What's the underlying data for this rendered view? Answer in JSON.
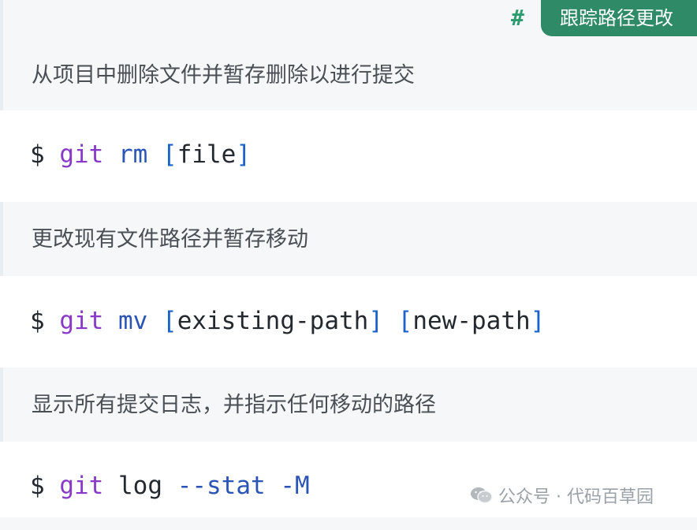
{
  "section": {
    "anchor": "#",
    "tag_label": "跟踪路径更改"
  },
  "items": [
    {
      "description": "从项目中删除文件并暂存删除以进行提交",
      "command": {
        "prompt": "$",
        "tool": "git",
        "subcommand": "rm",
        "args": [
          {
            "open": "[",
            "text": "file",
            "close": "]"
          }
        ],
        "flags": []
      }
    },
    {
      "description": "更改现有文件路径并暂存移动",
      "command": {
        "prompt": "$",
        "tool": "git",
        "subcommand": "mv",
        "args": [
          {
            "open": "[",
            "text": "existing-path",
            "close": "]"
          },
          {
            "open": "[",
            "text": "new-path",
            "close": "]"
          }
        ],
        "flags": []
      }
    },
    {
      "description": "显示所有提交日志，并指示任何移动的路径",
      "command": {
        "prompt": "$",
        "tool": "git",
        "subcommand": "log",
        "args": [],
        "flags": [
          "--stat",
          "-M"
        ]
      }
    }
  ],
  "watermark": {
    "text": "公众号 · 代码百草园",
    "icon": "wechat-icon"
  }
}
